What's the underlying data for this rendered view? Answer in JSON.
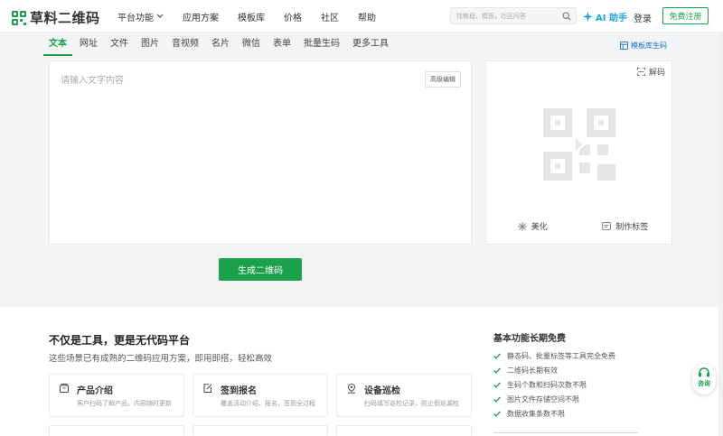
{
  "brand": {
    "name": "草料二维码",
    "color": "#19a14b"
  },
  "nav": {
    "items": [
      "平台功能",
      "应用方案",
      "模板库",
      "价格",
      "社区",
      "帮助"
    ],
    "search_placeholder": "找教程、模板，社区问答",
    "ai_label": "AI 助手",
    "login": "登录",
    "register": "免费注册"
  },
  "tabs": {
    "items": [
      "文本",
      "网址",
      "文件",
      "图片",
      "音视频",
      "名片",
      "微信",
      "表单",
      "批量生码",
      "更多工具"
    ],
    "active": "文本",
    "template_link": "模板库生码"
  },
  "editor": {
    "placeholder": "请输入文字内容",
    "advanced": "高级编辑"
  },
  "preview": {
    "decode": "解码",
    "beautify": "美化",
    "label": "制作标签"
  },
  "generate": "生成二维码",
  "promo": {
    "title": "不仅是工具，更是无代码平台",
    "subtitle": "这些场景已有成熟的二维码应用方案，即用即搭，轻松高效",
    "cards": [
      {
        "title": "产品介绍",
        "desc": "客户扫码了解产品，内容随时更新",
        "icon": "box-icon"
      },
      {
        "title": "签到报名",
        "desc": "覆盖活动介绍、报名、签到全过程",
        "icon": "edit-icon"
      },
      {
        "title": "设备巡检",
        "desc": "扫码填写巡检记录，防止假巡漏检",
        "icon": "location-icon"
      }
    ]
  },
  "free": {
    "title": "基本功能长期免费",
    "items": [
      "静态码、批量标签等工具完全免费",
      "二维码长期有效",
      "生码个数和扫码次数不限",
      "图片文件存储空间不限",
      "数据收集条数不限"
    ]
  },
  "consult": "咨询"
}
